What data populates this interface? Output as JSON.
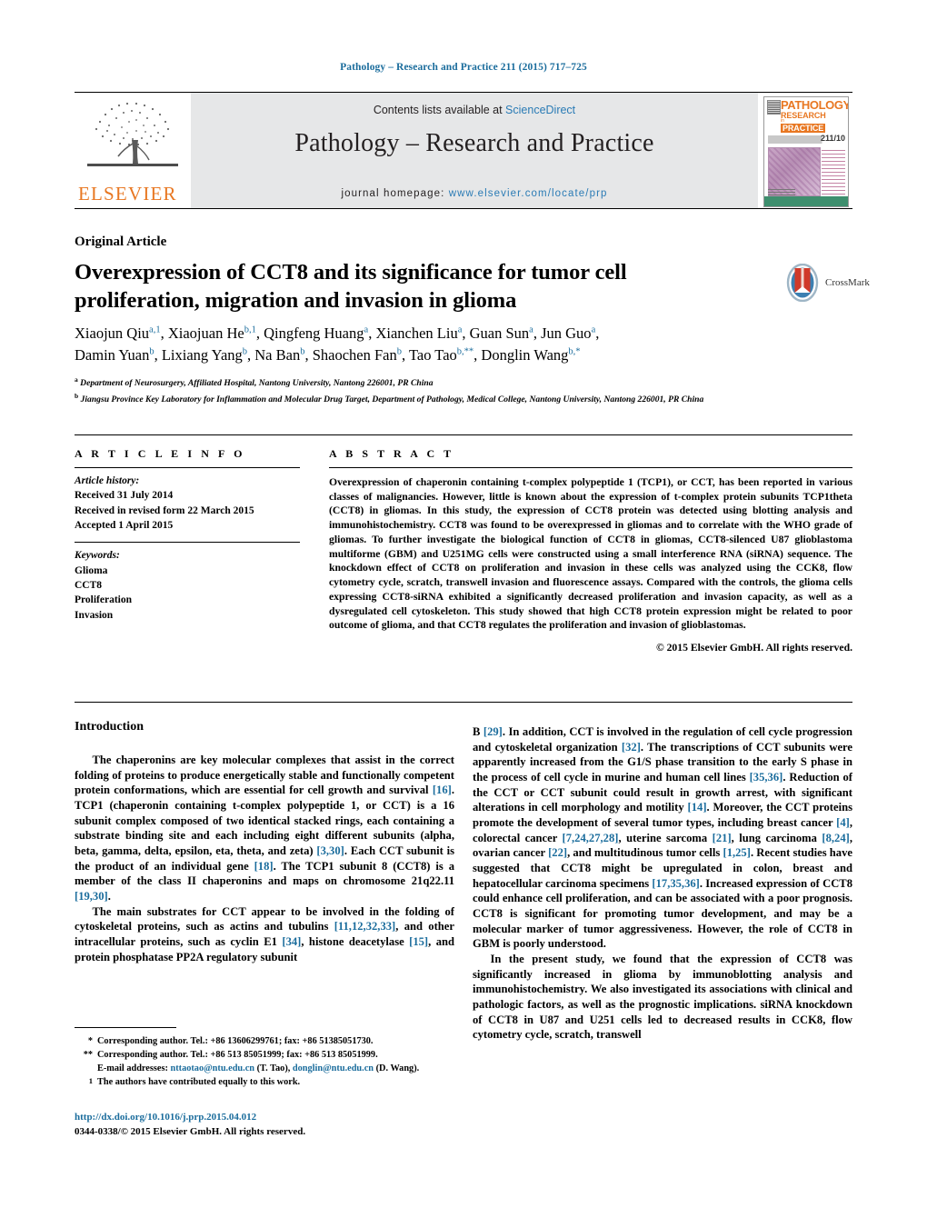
{
  "running_head": "Pathology – Research and Practice 211 (2015) 717–725",
  "masthead": {
    "contents_prefix": "Contents lists available at ",
    "contents_link": "ScienceDirect",
    "journal_title": "Pathology – Research and Practice",
    "homepage_prefix": "journal homepage:",
    "homepage_url": "www.elsevier.com/locate/prp",
    "publisher": "ELSEVIER",
    "cover": {
      "line1": "PATHOLOGY",
      "line2": "RESEARCH",
      "line3": "in",
      "line4": "PRACTICE",
      "volume": "211/10"
    }
  },
  "article": {
    "type": "Original Article",
    "title": "Overexpression of CCT8 and its significance for tumor cell proliferation, migration and invasion in glioma",
    "crossmark_label": "CrossMark",
    "authors_line1": "Xiaojun Qiu a,1, Xiaojuan He b,1, Qingfeng Huang a, Xianchen Liu a, Guan Sun a, Jun Guo a,",
    "authors_line2": "Damin Yuan b, Lixiang Yang b, Na Ban b, Shaochen Fan b, Tao Tao b,**, Donglin Wang b,*",
    "authors": [
      {
        "name": "Xiaojun Qiu",
        "sup": "a,1"
      },
      {
        "name": "Xiaojuan He",
        "sup": "b,1"
      },
      {
        "name": "Qingfeng Huang",
        "sup": "a"
      },
      {
        "name": "Xianchen Liu",
        "sup": "a"
      },
      {
        "name": "Guan Sun",
        "sup": "a"
      },
      {
        "name": "Jun Guo",
        "sup": "a"
      },
      {
        "name": "Damin Yuan",
        "sup": "b"
      },
      {
        "name": "Lixiang Yang",
        "sup": "b"
      },
      {
        "name": "Na Ban",
        "sup": "b"
      },
      {
        "name": "Shaochen Fan",
        "sup": "b"
      },
      {
        "name": "Tao Tao",
        "sup": "b,**"
      },
      {
        "name": "Donglin Wang",
        "sup": "b,*"
      }
    ],
    "affiliation_a": "Department of Neurosurgery, Affiliated Hospital, Nantong University, Nantong 226001, PR China",
    "affiliation_b": "Jiangsu Province Key Laboratory for Inflammation and Molecular Drug Target, Department of Pathology, Medical College, Nantong University, Nantong 226001, PR China"
  },
  "article_info": {
    "heading": "A R T I C L E   I N F O",
    "history_label": "Article history:",
    "received": "Received 31 July 2014",
    "revised": "Received in revised form 22 March 2015",
    "accepted": "Accepted 1 April 2015",
    "keywords_label": "Keywords:",
    "keywords": [
      "Glioma",
      "CCT8",
      "Proliferation",
      "Invasion"
    ]
  },
  "abstract": {
    "heading": "A B S T R A C T",
    "text": "Overexpression of chaperonin containing t-complex polypeptide 1 (TCP1), or CCT, has been reported in various classes of malignancies. However, little is known about the expression of t-complex protein subunits TCP1theta (CCT8) in gliomas. In this study, the expression of CCT8 protein was detected using blotting analysis and immunohistochemistry. CCT8 was found to be overexpressed in gliomas and to correlate with the WHO grade of gliomas. To further investigate the biological function of CCT8 in gliomas, CCT8-silenced U87 glioblastoma multiforme (GBM) and U251MG cells were constructed using a small interference RNA (siRNA) sequence. The knockdown effect of CCT8 on proliferation and invasion in these cells was analyzed using the CCK8, flow cytometry cycle, scratch, transwell invasion and fluorescence assays. Compared with the controls, the glioma cells expressing CCT8-siRNA exhibited a significantly decreased proliferation and invasion capacity, as well as a dysregulated cell cytoskeleton. This study showed that high CCT8 protein expression might be related to poor outcome of glioma, and that CCT8 regulates the proliferation and invasion of glioblastomas.",
    "copyright": "© 2015 Elsevier GmbH. All rights reserved."
  },
  "introduction": {
    "heading": "Introduction",
    "left_p1": "The chaperonins are key molecular complexes that assist in the correct folding of proteins to produce energetically stable and functionally competent protein conformations, which are essential for cell growth and survival [16]. TCP1 (chaperonin containing t-complex polypeptide 1, or CCT) is a 16 subunit complex composed of two identical stacked rings, each containing a substrate binding site and each including eight different subunits (alpha, beta, gamma, delta, epsilon, eta, theta, and zeta) [3,30]. Each CCT subunit is the product of an individual gene [18]. The TCP1 subunit 8 (CCT8) is a member of the class II chaperonins and maps on chromosome 21q22.11 [19,30].",
    "left_p2": "The main substrates for CCT appear to be involved in the folding of cytoskeletal proteins, such as actins and tubulins [11,12,32,33], and other intracellular proteins, such as cyclin E1 [34], histone deacetylase [15], and protein phosphatase PP2A regulatory subunit",
    "right_p1": "B [29]. In addition, CCT is involved in the regulation of cell cycle progression and cytoskeletal organization [32]. The transcriptions of CCT subunits were apparently increased from the G1/S phase transition to the early S phase in the process of cell cycle in murine and human cell lines [35,36]. Reduction of the CCT or CCT subunit could result in growth arrest, with significant alterations in cell morphology and motility [14]. Moreover, the CCT proteins promote the development of several tumor types, including breast cancer [4], colorectal cancer [7,24,27,28], uterine sarcoma [21], lung carcinoma [8,24], ovarian cancer [22], and multitudinous tumor cells [1,25]. Recent studies have suggested that CCT8 might be upregulated in colon, breast and hepatocellular carcinoma specimens [17,35,36]. Increased expression of CCT8 could enhance cell proliferation, and can be associated with a poor prognosis. CCT8 is significant for promoting tumor development, and may be a molecular marker of tumor aggressiveness. However, the role of CCT8 in GBM is poorly understood.",
    "right_p2": "In the present study, we found that the expression of CCT8 was significantly increased in glioma by immunoblotting analysis and immunohistochemistry. We also investigated its associations with clinical and pathologic factors, as well as the prognostic implications. siRNA knockdown of CCT8 in U87 and U251 cells led to decreased results in CCK8, flow cytometry cycle, scratch, transwell"
  },
  "footnotes": {
    "note1_mark": "*",
    "note1_text": "Corresponding author. Tel.: +86 13606299761; fax: +86 51385051730.",
    "note2_mark": "**",
    "note2_text": "Corresponding author. Tel.: +86 513 85051999; fax: +86 513 85051999.",
    "email_label": "E-mail addresses:",
    "email1": "nttaotao@ntu.edu.cn",
    "email1_owner": "(T. Tao),",
    "email2": "donglin@ntu.edu.cn",
    "email2_owner": "(D. Wang).",
    "note3_mark": "1",
    "note3_text": "The authors have contributed equally to this work."
  },
  "footer": {
    "doi": "http://dx.doi.org/10.1016/j.prp.2015.04.012",
    "issn_line": "0344-0338/© 2015 Elsevier GmbH. All rights reserved."
  },
  "colors": {
    "link": "#1a6c9c",
    "elsevier_orange": "#E87722",
    "panel_grey": "#e6e7e8"
  }
}
